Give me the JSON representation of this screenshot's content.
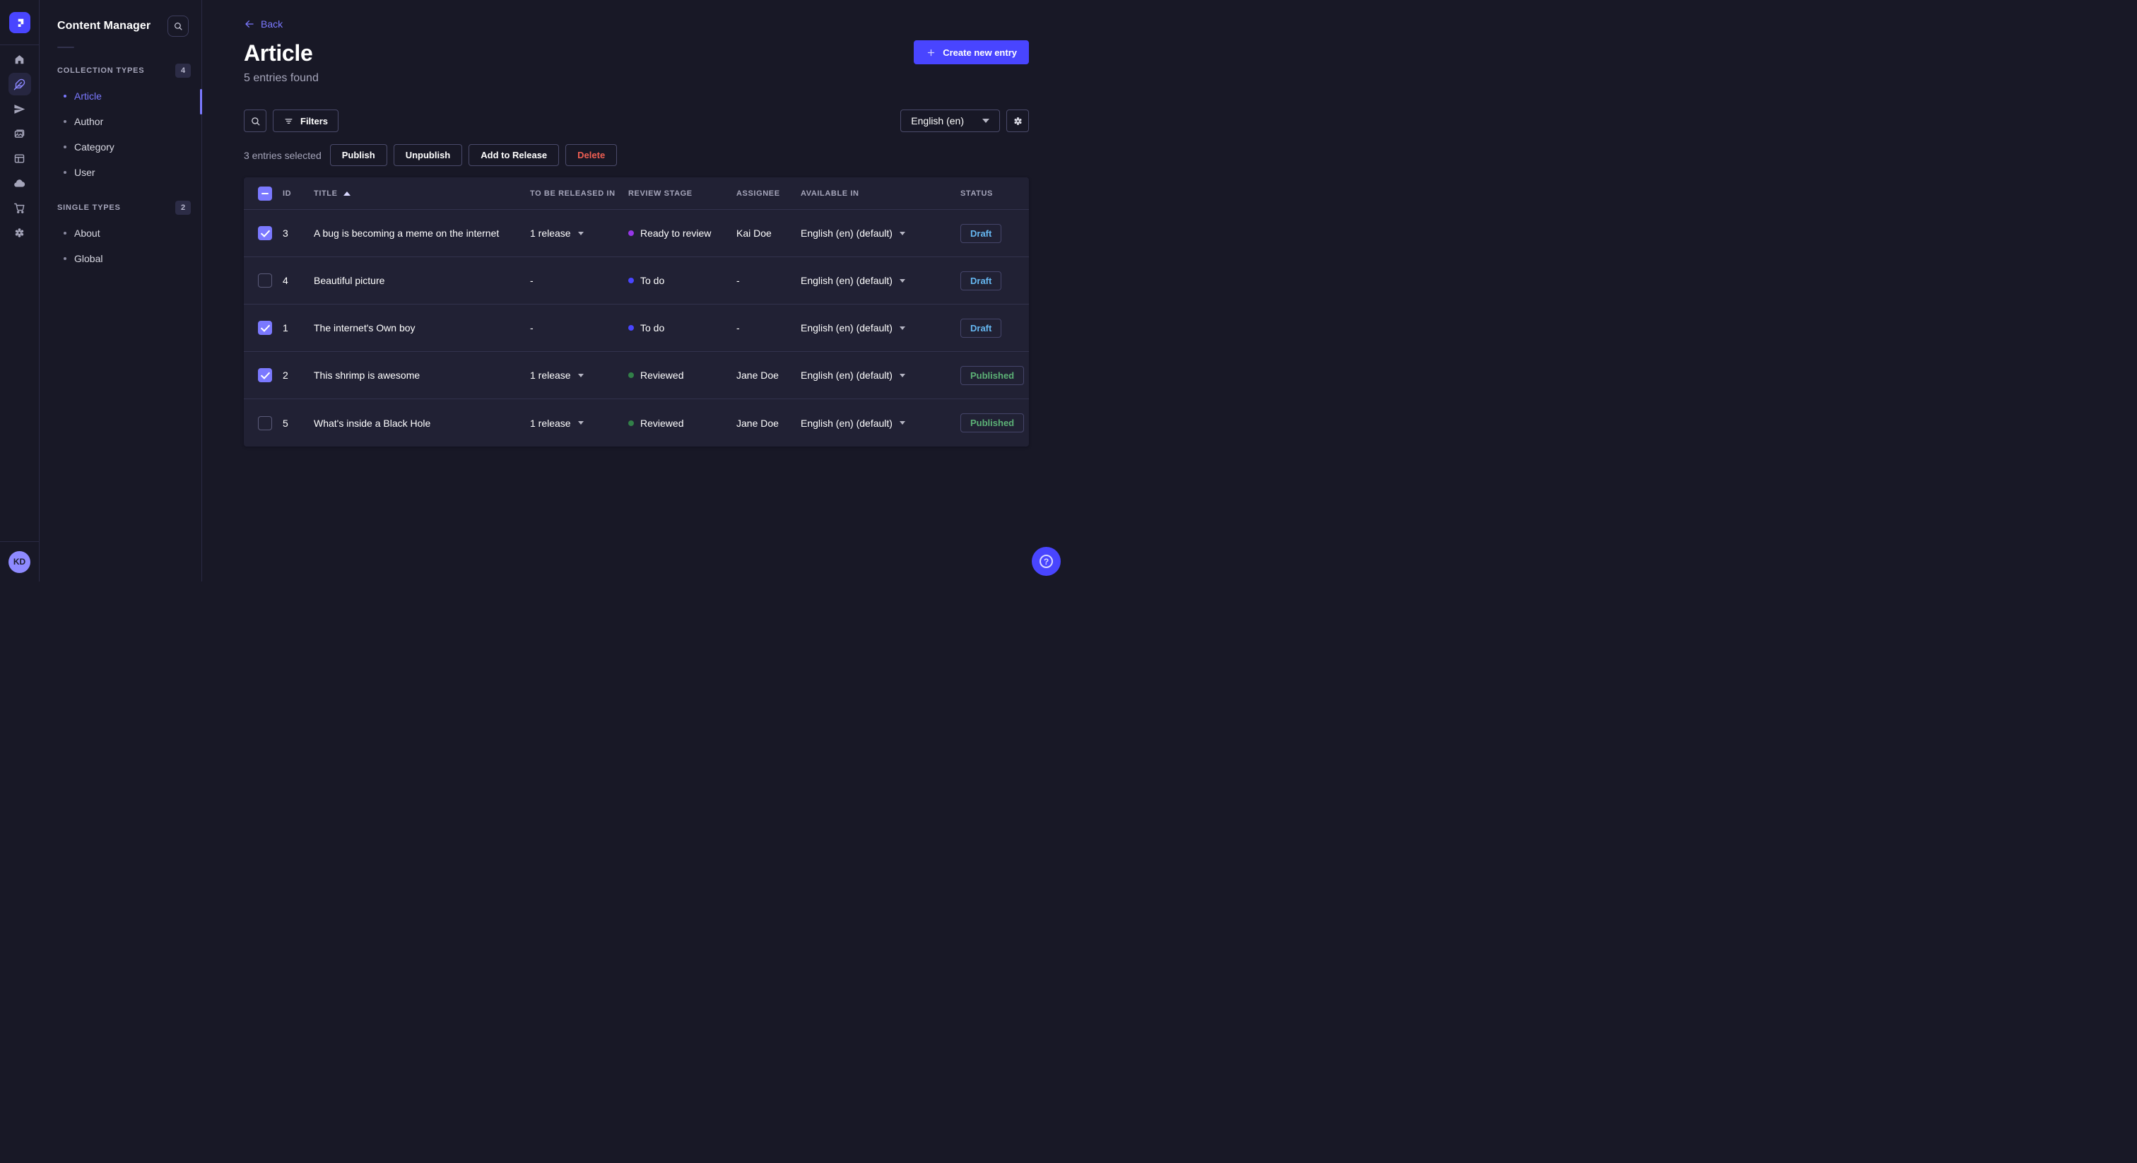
{
  "nav": {
    "rail": {
      "items": [
        {
          "icon": "home",
          "active": false
        },
        {
          "icon": "feather-content-manager",
          "active": true
        },
        {
          "icon": "paper-plane",
          "active": false
        },
        {
          "icon": "media-library-images",
          "active": false
        },
        {
          "icon": "layout-builder",
          "active": false
        },
        {
          "icon": "cloud",
          "active": false
        },
        {
          "icon": "shopping-cart",
          "active": false
        },
        {
          "icon": "settings-gear",
          "active": false
        }
      ]
    },
    "user_initials": "KD"
  },
  "sidebar": {
    "title": "Content Manager",
    "sections": [
      {
        "label": "COLLECTION TYPES",
        "count": "4",
        "items": [
          {
            "label": "Article",
            "active": true
          },
          {
            "label": "Author",
            "active": false
          },
          {
            "label": "Category",
            "active": false
          },
          {
            "label": "User",
            "active": false
          }
        ]
      },
      {
        "label": "SINGLE TYPES",
        "count": "2",
        "items": [
          {
            "label": "About",
            "active": false
          },
          {
            "label": "Global",
            "active": false
          }
        ]
      }
    ]
  },
  "header": {
    "back_label": "Back",
    "title": "Article",
    "subtitle": "5 entries found",
    "create_button_label": "Create new entry"
  },
  "toolbar": {
    "filters_label": "Filters",
    "locale_value": "English (en)"
  },
  "selection": {
    "text": "3 entries selected",
    "actions": [
      {
        "label": "Publish"
      },
      {
        "label": "Unpublish"
      },
      {
        "label": "Add to Release"
      },
      {
        "label": "Delete",
        "variant": "danger"
      }
    ]
  },
  "table": {
    "select_all_indeterminate": true,
    "columns": [
      "ID",
      "TITLE",
      "TO BE RELEASED IN",
      "REVIEW STAGE",
      "ASSIGNEE",
      "AVAILABLE IN",
      "STATUS"
    ],
    "sort_column": "TITLE",
    "sort_direction": "asc",
    "rows": [
      {
        "checked": true,
        "id": "3",
        "title": "A bug is becoming a meme on the internet",
        "release": "1 release",
        "has_release_menu": true,
        "stage": "Ready to review",
        "stage_kind": "ready",
        "assignee": "Kai Doe",
        "locale": "English (en) (default)",
        "status": "Draft",
        "status_kind": "draft"
      },
      {
        "checked": false,
        "id": "4",
        "title": "Beautiful picture",
        "release": "-",
        "has_release_menu": false,
        "stage": "To do",
        "stage_kind": "todo",
        "assignee": "-",
        "locale": "English (en) (default)",
        "status": "Draft",
        "status_kind": "draft"
      },
      {
        "checked": true,
        "id": "1",
        "title": "The internet's Own boy",
        "release": "-",
        "has_release_menu": false,
        "stage": "To do",
        "stage_kind": "todo",
        "assignee": "-",
        "locale": "English (en) (default)",
        "status": "Draft",
        "status_kind": "draft"
      },
      {
        "checked": true,
        "id": "2",
        "title": "This shrimp is awesome",
        "release": "1 release",
        "has_release_menu": true,
        "stage": "Reviewed",
        "stage_kind": "reviewed",
        "assignee": "Jane Doe",
        "locale": "English (en) (default)",
        "status": "Published",
        "status_kind": "published"
      },
      {
        "checked": false,
        "id": "5",
        "title": "What's inside a Black Hole",
        "release": "1 release",
        "has_release_menu": true,
        "stage": "Reviewed",
        "stage_kind": "reviewed",
        "assignee": "Jane Doe",
        "locale": "English (en) (default)",
        "status": "Published",
        "status_kind": "published"
      }
    ]
  },
  "colors": {
    "accent": "#4945ff",
    "accent_light": "#7b79ff",
    "page_bg": "#181826",
    "card_bg": "#212134",
    "border": "#32324d",
    "muted_text": "#a5a5ba",
    "status_draft": "#66b7f1",
    "status_published": "#5cb176",
    "danger": "#ee5e52",
    "stage_todo": "#4945ff",
    "stage_ready": "#9736e8",
    "stage_reviewed": "#328048"
  }
}
